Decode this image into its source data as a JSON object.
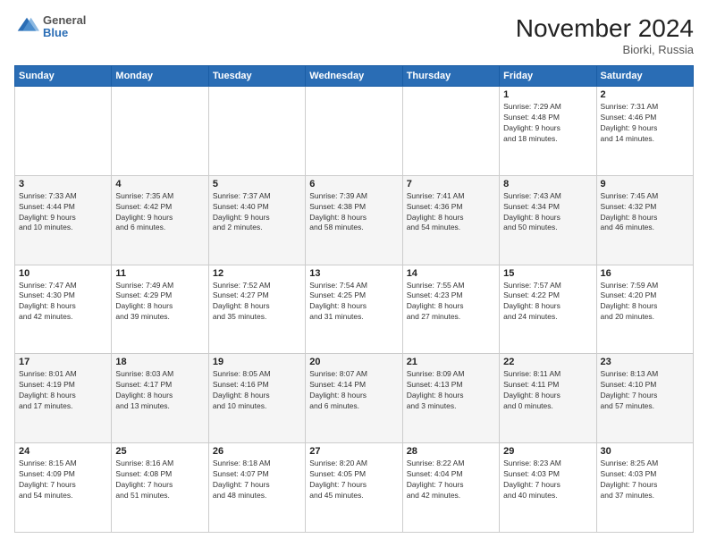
{
  "header": {
    "logo": {
      "general": "General",
      "blue": "Blue"
    },
    "title": "November 2024",
    "location": "Biorki, Russia"
  },
  "weekdays": [
    "Sunday",
    "Monday",
    "Tuesday",
    "Wednesday",
    "Thursday",
    "Friday",
    "Saturday"
  ],
  "weeks": [
    [
      {
        "day": "",
        "info": ""
      },
      {
        "day": "",
        "info": ""
      },
      {
        "day": "",
        "info": ""
      },
      {
        "day": "",
        "info": ""
      },
      {
        "day": "",
        "info": ""
      },
      {
        "day": "1",
        "info": "Sunrise: 7:29 AM\nSunset: 4:48 PM\nDaylight: 9 hours\nand 18 minutes."
      },
      {
        "day": "2",
        "info": "Sunrise: 7:31 AM\nSunset: 4:46 PM\nDaylight: 9 hours\nand 14 minutes."
      }
    ],
    [
      {
        "day": "3",
        "info": "Sunrise: 7:33 AM\nSunset: 4:44 PM\nDaylight: 9 hours\nand 10 minutes."
      },
      {
        "day": "4",
        "info": "Sunrise: 7:35 AM\nSunset: 4:42 PM\nDaylight: 9 hours\nand 6 minutes."
      },
      {
        "day": "5",
        "info": "Sunrise: 7:37 AM\nSunset: 4:40 PM\nDaylight: 9 hours\nand 2 minutes."
      },
      {
        "day": "6",
        "info": "Sunrise: 7:39 AM\nSunset: 4:38 PM\nDaylight: 8 hours\nand 58 minutes."
      },
      {
        "day": "7",
        "info": "Sunrise: 7:41 AM\nSunset: 4:36 PM\nDaylight: 8 hours\nand 54 minutes."
      },
      {
        "day": "8",
        "info": "Sunrise: 7:43 AM\nSunset: 4:34 PM\nDaylight: 8 hours\nand 50 minutes."
      },
      {
        "day": "9",
        "info": "Sunrise: 7:45 AM\nSunset: 4:32 PM\nDaylight: 8 hours\nand 46 minutes."
      }
    ],
    [
      {
        "day": "10",
        "info": "Sunrise: 7:47 AM\nSunset: 4:30 PM\nDaylight: 8 hours\nand 42 minutes."
      },
      {
        "day": "11",
        "info": "Sunrise: 7:49 AM\nSunset: 4:29 PM\nDaylight: 8 hours\nand 39 minutes."
      },
      {
        "day": "12",
        "info": "Sunrise: 7:52 AM\nSunset: 4:27 PM\nDaylight: 8 hours\nand 35 minutes."
      },
      {
        "day": "13",
        "info": "Sunrise: 7:54 AM\nSunset: 4:25 PM\nDaylight: 8 hours\nand 31 minutes."
      },
      {
        "day": "14",
        "info": "Sunrise: 7:55 AM\nSunset: 4:23 PM\nDaylight: 8 hours\nand 27 minutes."
      },
      {
        "day": "15",
        "info": "Sunrise: 7:57 AM\nSunset: 4:22 PM\nDaylight: 8 hours\nand 24 minutes."
      },
      {
        "day": "16",
        "info": "Sunrise: 7:59 AM\nSunset: 4:20 PM\nDaylight: 8 hours\nand 20 minutes."
      }
    ],
    [
      {
        "day": "17",
        "info": "Sunrise: 8:01 AM\nSunset: 4:19 PM\nDaylight: 8 hours\nand 17 minutes."
      },
      {
        "day": "18",
        "info": "Sunrise: 8:03 AM\nSunset: 4:17 PM\nDaylight: 8 hours\nand 13 minutes."
      },
      {
        "day": "19",
        "info": "Sunrise: 8:05 AM\nSunset: 4:16 PM\nDaylight: 8 hours\nand 10 minutes."
      },
      {
        "day": "20",
        "info": "Sunrise: 8:07 AM\nSunset: 4:14 PM\nDaylight: 8 hours\nand 6 minutes."
      },
      {
        "day": "21",
        "info": "Sunrise: 8:09 AM\nSunset: 4:13 PM\nDaylight: 8 hours\nand 3 minutes."
      },
      {
        "day": "22",
        "info": "Sunrise: 8:11 AM\nSunset: 4:11 PM\nDaylight: 8 hours\nand 0 minutes."
      },
      {
        "day": "23",
        "info": "Sunrise: 8:13 AM\nSunset: 4:10 PM\nDaylight: 7 hours\nand 57 minutes."
      }
    ],
    [
      {
        "day": "24",
        "info": "Sunrise: 8:15 AM\nSunset: 4:09 PM\nDaylight: 7 hours\nand 54 minutes."
      },
      {
        "day": "25",
        "info": "Sunrise: 8:16 AM\nSunset: 4:08 PM\nDaylight: 7 hours\nand 51 minutes."
      },
      {
        "day": "26",
        "info": "Sunrise: 8:18 AM\nSunset: 4:07 PM\nDaylight: 7 hours\nand 48 minutes."
      },
      {
        "day": "27",
        "info": "Sunrise: 8:20 AM\nSunset: 4:05 PM\nDaylight: 7 hours\nand 45 minutes."
      },
      {
        "day": "28",
        "info": "Sunrise: 8:22 AM\nSunset: 4:04 PM\nDaylight: 7 hours\nand 42 minutes."
      },
      {
        "day": "29",
        "info": "Sunrise: 8:23 AM\nSunset: 4:03 PM\nDaylight: 7 hours\nand 40 minutes."
      },
      {
        "day": "30",
        "info": "Sunrise: 8:25 AM\nSunset: 4:03 PM\nDaylight: 7 hours\nand 37 minutes."
      }
    ]
  ]
}
